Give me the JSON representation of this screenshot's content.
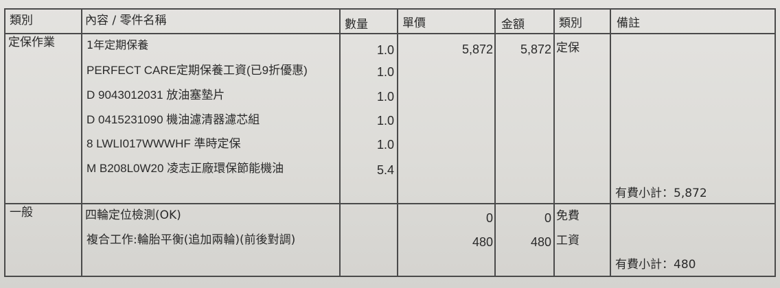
{
  "headers": {
    "category": "類別",
    "content": "內容 / 零件名稱",
    "qty": "數量",
    "unit_price": "單價",
    "amount": "金額",
    "type": "類別",
    "remarks": "備註"
  },
  "groups": [
    {
      "category": "定保作業",
      "rows": [
        {
          "item": "1年定期保養",
          "qty": "1.0",
          "unit_price": "5,872",
          "amount": "5,872",
          "type": "定保"
        },
        {
          "item": "PERFECT CARE定期保養工資(已9折優惠)",
          "qty": "1.0",
          "unit_price": "",
          "amount": "",
          "type": ""
        },
        {
          "item": "D 9043012031 放油塞墊片",
          "qty": "1.0",
          "unit_price": "",
          "amount": "",
          "type": ""
        },
        {
          "item": "D 0415231090 機油濾清器濾芯組",
          "qty": "1.0",
          "unit_price": "",
          "amount": "",
          "type": ""
        },
        {
          "item": "8 LWLI017WWWHF 準時定保",
          "qty": "1.0",
          "unit_price": "",
          "amount": "",
          "type": ""
        },
        {
          "item": "M B208L0W20 凌志正廠環保節能機油",
          "qty": "5.4",
          "unit_price": "",
          "amount": "",
          "type": ""
        }
      ],
      "subtotal": "有費小計：5,872"
    },
    {
      "category": "一般",
      "rows": [
        {
          "item": "四輪定位檢測(OK)",
          "qty": "",
          "unit_price": "0",
          "amount": "0",
          "type": "免費"
        },
        {
          "item": "複合工作:輪胎平衡(追加兩輪)(前後對調)",
          "qty": "",
          "unit_price": "480",
          "amount": "480",
          "type": "工資"
        }
      ],
      "subtotal": "有費小計：480"
    }
  ]
}
